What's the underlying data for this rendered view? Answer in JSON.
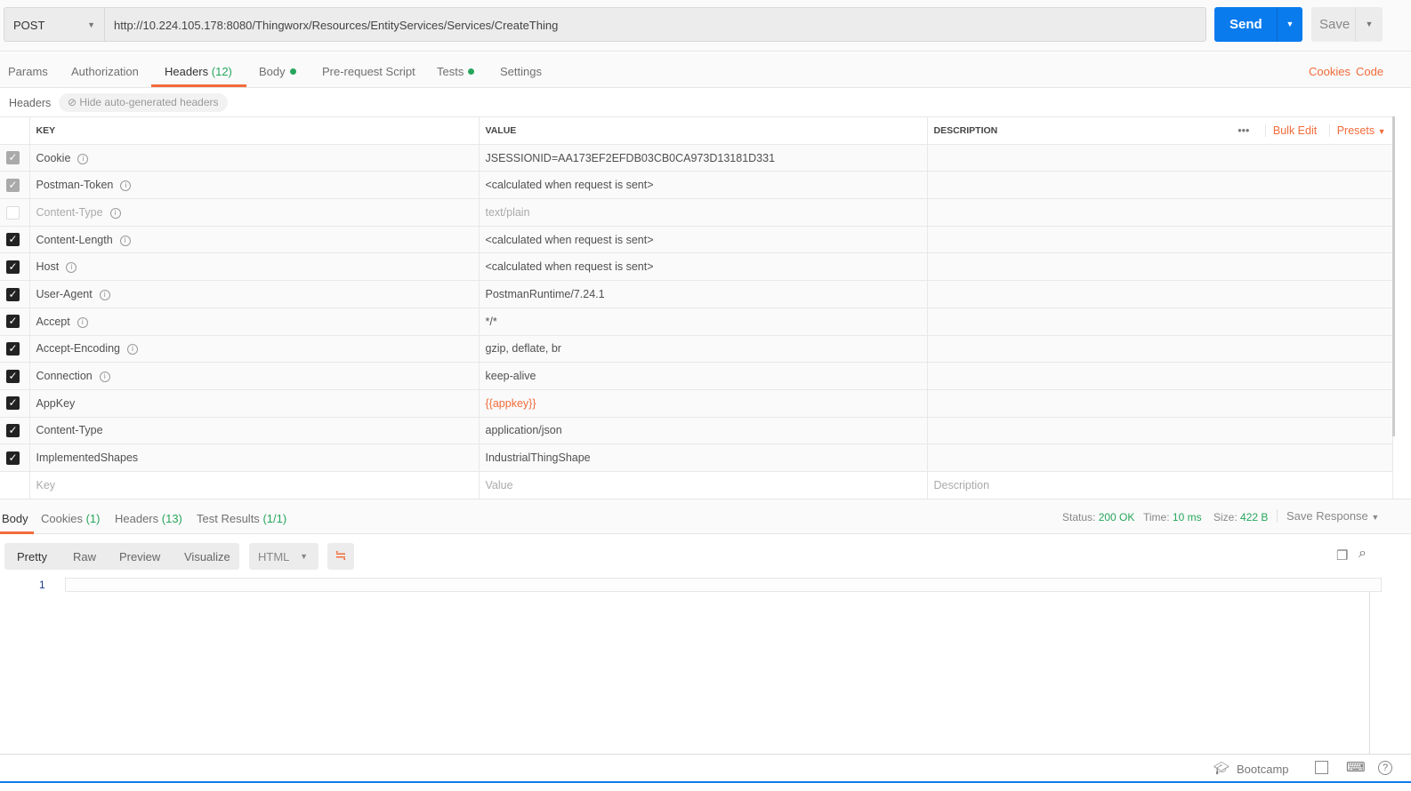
{
  "request": {
    "method": "POST",
    "url": "http://10.224.105.178:8080/Thingworx/Resources/EntityServices/Services/CreateThing",
    "send_label": "Send",
    "save_label": "Save"
  },
  "tabs": {
    "params": "Params",
    "authorization": "Authorization",
    "headers": "Headers",
    "headers_count": "(12)",
    "body": "Body",
    "prerequest": "Pre-request Script",
    "tests": "Tests",
    "settings": "Settings",
    "cookies": "Cookies",
    "code": "Code"
  },
  "headers_bar": {
    "title": "Headers",
    "hide_auto": "Hide auto-generated headers"
  },
  "table": {
    "col_key": "KEY",
    "col_value": "VALUE",
    "col_description": "DESCRIPTION",
    "more": "•••",
    "bulk_edit": "Bulk Edit",
    "presets": "Presets",
    "rows": [
      {
        "key": "Cookie",
        "value": "JSESSIONID=AA173EF2EFDB03CB0CA973D13181D331",
        "state": "auto",
        "info": true
      },
      {
        "key": "Postman-Token",
        "value": "<calculated when request is sent>",
        "state": "auto",
        "info": true
      },
      {
        "key": "Content-Type",
        "value": "text/plain",
        "state": "off",
        "info": true
      },
      {
        "key": "Content-Length",
        "value": "<calculated when request is sent>",
        "state": "on",
        "info": true
      },
      {
        "key": "Host",
        "value": "<calculated when request is sent>",
        "state": "on",
        "info": true
      },
      {
        "key": "User-Agent",
        "value": "PostmanRuntime/7.24.1",
        "state": "on",
        "info": true
      },
      {
        "key": "Accept",
        "value": "*/*",
        "state": "on",
        "info": true
      },
      {
        "key": "Accept-Encoding",
        "value": "gzip, deflate, br",
        "state": "on",
        "info": true
      },
      {
        "key": "Connection",
        "value": "keep-alive",
        "state": "on",
        "info": true
      },
      {
        "key": "AppKey",
        "value": "{{appkey}}",
        "state": "on",
        "info": false,
        "variable": true
      },
      {
        "key": "Content-Type",
        "value": "application/json",
        "state": "on",
        "info": false
      },
      {
        "key": "ImplementedShapes",
        "value": "IndustrialThingShape",
        "state": "on",
        "info": false
      }
    ],
    "placeholder_key": "Key",
    "placeholder_value": "Value",
    "placeholder_description": "Description"
  },
  "response": {
    "body": "Body",
    "cookies": "Cookies",
    "cookies_count": "(1)",
    "headers": "Headers",
    "headers_count": "(13)",
    "tests": "Test Results",
    "tests_count": "(1/1)",
    "status_label": "Status:",
    "status": "200 OK",
    "time_label": "Time:",
    "time": "10 ms",
    "size_label": "Size:",
    "size": "422 B",
    "save_response": "Save Response",
    "views": [
      "Pretty",
      "Raw",
      "Preview",
      "Visualize"
    ],
    "format": "HTML",
    "line_number": "1"
  },
  "footer": {
    "bootcamp": "Bootcamp"
  },
  "colors": {
    "accent": "#f26b3a",
    "send": "#097bed",
    "success": "#26a65b"
  }
}
